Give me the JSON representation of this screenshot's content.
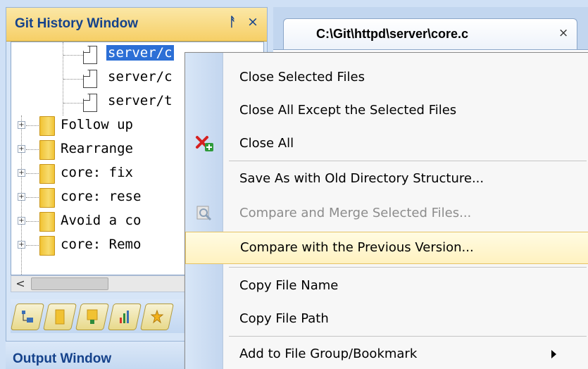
{
  "git_window": {
    "title": "Git History Window",
    "tree": [
      {
        "kind": "file",
        "text": "server/c",
        "selected": true
      },
      {
        "kind": "file",
        "text": "server/c",
        "selected": false
      },
      {
        "kind": "file",
        "text": "server/t",
        "selected": false
      },
      {
        "kind": "commit",
        "text": "Follow up"
      },
      {
        "kind": "commit",
        "text": "Rearrange"
      },
      {
        "kind": "commit",
        "text": "core: fix"
      },
      {
        "kind": "commit",
        "text": "core: rese"
      },
      {
        "kind": "commit",
        "text": "Avoid a co"
      },
      {
        "kind": "commit",
        "text": "core: Remo"
      }
    ],
    "scroll_left_glyph": "<",
    "tab_icons": [
      "tree-view-icon",
      "folder-icon",
      "branch-icon",
      "chart-icon",
      "star-icon"
    ]
  },
  "output_window": {
    "title": "Output Window"
  },
  "editor": {
    "tab_title": "C:\\Git\\httpd\\server\\core.c",
    "tab_close_glyph": "×"
  },
  "context_menu": {
    "items": [
      {
        "label": "Close Selected Files",
        "enabled": true
      },
      {
        "label": "Close All Except the Selected Files",
        "enabled": true
      },
      {
        "label": "Close All",
        "enabled": true,
        "icon": "close-all-icon"
      },
      {
        "label": "Save As with Old Directory Structure...",
        "enabled": true
      },
      {
        "label": "Compare and Merge Selected Files...",
        "enabled": false,
        "icon": "compare-icon"
      },
      {
        "label": "Compare with the Previous Version...",
        "enabled": true,
        "highlighted": true
      },
      {
        "label": "Copy File Name",
        "enabled": true
      },
      {
        "label": "Copy File Path",
        "enabled": true
      },
      {
        "label": "Add to File Group/Bookmark",
        "enabled": true,
        "submenu": true
      }
    ]
  },
  "colors": {
    "header_gold": "#f6cf66",
    "title_blue": "#15428b",
    "selection_blue": "#2c6fd6",
    "menu_highlight": "#fff2c0"
  }
}
